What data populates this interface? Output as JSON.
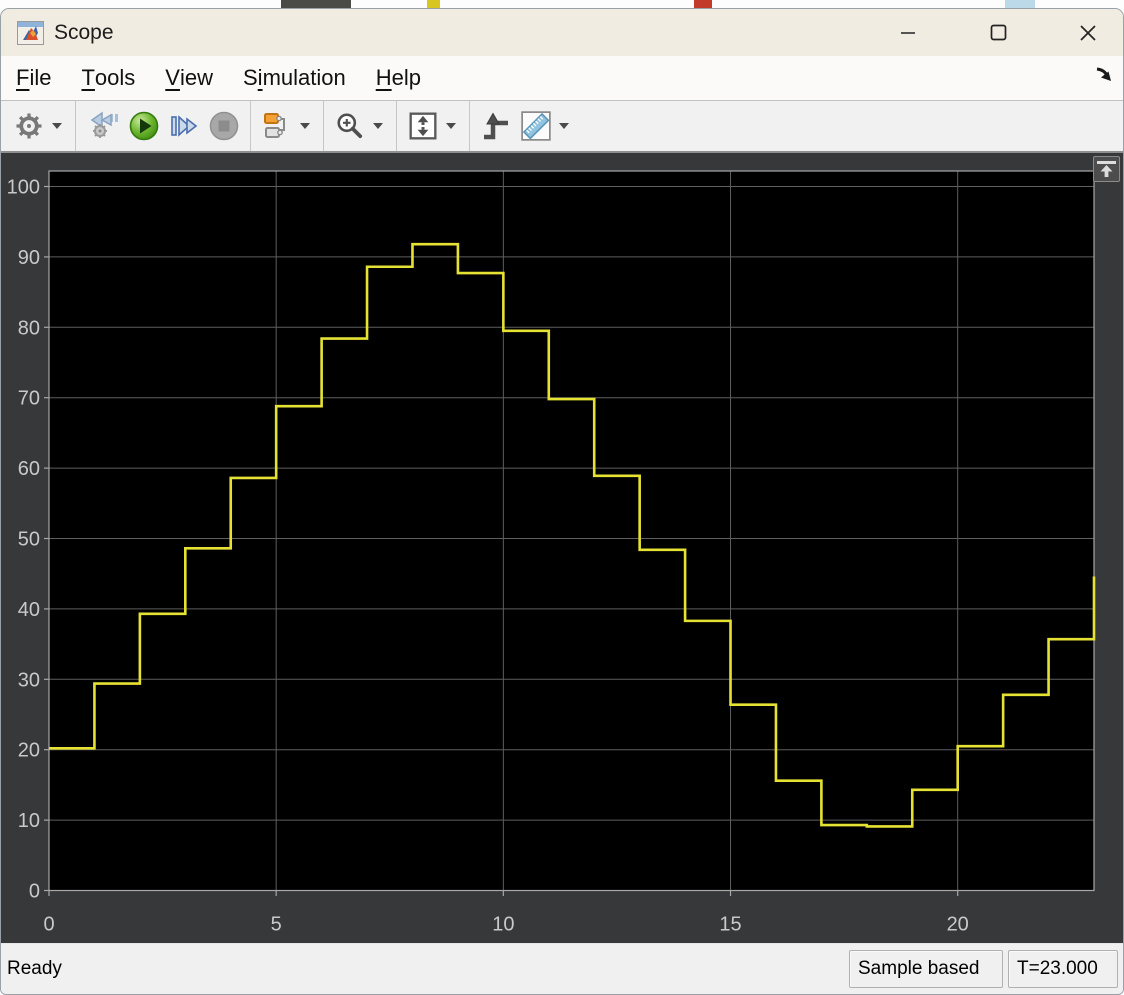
{
  "titlebar": {
    "title": "Scope"
  },
  "menu": {
    "items": [
      {
        "label": "File",
        "accel": "F"
      },
      {
        "label": "Tools",
        "accel": "T"
      },
      {
        "label": "View",
        "accel": "V"
      },
      {
        "label": "Simulation",
        "accel": "i"
      },
      {
        "label": "Help",
        "accel": "H"
      }
    ]
  },
  "toolbar": {
    "buttons": [
      {
        "name": "settings",
        "icon": "gear-icon",
        "dropdown": true,
        "disabled": false
      },
      {
        "name": "step-back",
        "icon": "step-back-icon",
        "dropdown": false,
        "disabled": true
      },
      {
        "name": "run",
        "icon": "play-icon",
        "dropdown": false,
        "disabled": false
      },
      {
        "name": "step-forward",
        "icon": "step-forward-icon",
        "dropdown": false,
        "disabled": false
      },
      {
        "name": "stop",
        "icon": "stop-icon",
        "dropdown": false,
        "disabled": true
      },
      {
        "name": "highlight-block",
        "icon": "blocks-icon",
        "dropdown": true,
        "disabled": false
      },
      {
        "name": "zoom",
        "icon": "magnifier-icon",
        "dropdown": true,
        "disabled": false
      },
      {
        "name": "fit-to-view",
        "icon": "fit-view-icon",
        "dropdown": true,
        "disabled": false
      },
      {
        "name": "trigger",
        "icon": "trigger-icon",
        "dropdown": false,
        "disabled": false
      },
      {
        "name": "measurements",
        "icon": "ruler-icon",
        "dropdown": true,
        "disabled": false
      }
    ]
  },
  "statusbar": {
    "status": "Ready",
    "mode": "Sample based",
    "time": "T=23.000"
  },
  "colors": {
    "trace": "#e6e233",
    "plot_bg": "#000000",
    "canvas_bg": "#37383a",
    "grid": "#5e5e5e",
    "axis_frame": "#a8a8a8",
    "tick_text": "#c9c9c9",
    "titlebar_bg": "#f1ece1",
    "toolbar_bg": "#f1f1f1",
    "run_green": "#58a317",
    "step_blue": "#4a6fae",
    "block_orange": "#f59b2d"
  },
  "chart_data": {
    "type": "line",
    "subtype": "stairstep-zero-order-hold",
    "title": "",
    "xlabel": "",
    "ylabel": "",
    "sample_time": 1,
    "x": [
      0,
      1,
      2,
      3,
      4,
      5,
      6,
      7,
      8,
      9,
      10,
      11,
      12,
      13,
      14,
      15,
      16,
      17,
      18,
      19,
      20,
      21,
      22,
      23
    ],
    "values": [
      20.2,
      29.4,
      39.3,
      48.6,
      58.6,
      68.8,
      78.4,
      88.6,
      91.8,
      87.7,
      79.5,
      69.8,
      58.9,
      48.4,
      38.3,
      26.4,
      15.6,
      9.3,
      9.1,
      14.3,
      20.5,
      27.8,
      35.7,
      44.6
    ],
    "xlim": [
      0,
      23
    ],
    "ylim": [
      0,
      100
    ],
    "xticks": [
      0,
      5,
      10,
      15,
      20
    ],
    "yticks": [
      0,
      10,
      20,
      30,
      40,
      50,
      60,
      70,
      80,
      90,
      100
    ],
    "grid": true,
    "legend": null,
    "line_color": "#e6e233",
    "background": "#000000"
  }
}
